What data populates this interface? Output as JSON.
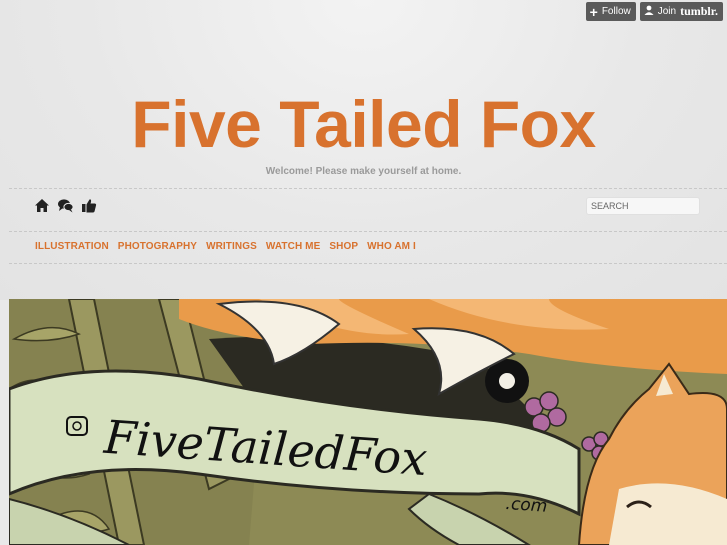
{
  "tumblr_bar": {
    "follow_label": "Follow",
    "join_label": "Join",
    "brand_label": "tumblr."
  },
  "header": {
    "title": "Five Tailed Fox",
    "tagline": "Welcome! Please make yourself at home."
  },
  "toolbar": {
    "icons": [
      "home-icon",
      "chat-bubbles-icon",
      "thumbs-up-icon"
    ]
  },
  "search": {
    "placeholder": "SEARCH"
  },
  "nav": {
    "items": [
      {
        "label": "ILLUSTRATION"
      },
      {
        "label": "PHOTOGRAPHY"
      },
      {
        "label": "WRITINGS"
      },
      {
        "label": "WATCH ME"
      },
      {
        "label": "SHOP"
      },
      {
        "label": "WHO AM I"
      }
    ]
  },
  "banner": {
    "logo_text": "FiveTailedFox",
    "logo_suffix": ".com"
  },
  "colors": {
    "accent": "#d8722e",
    "background": "#e9e9e9",
    "tumblr_button": "#5a5a5a"
  }
}
